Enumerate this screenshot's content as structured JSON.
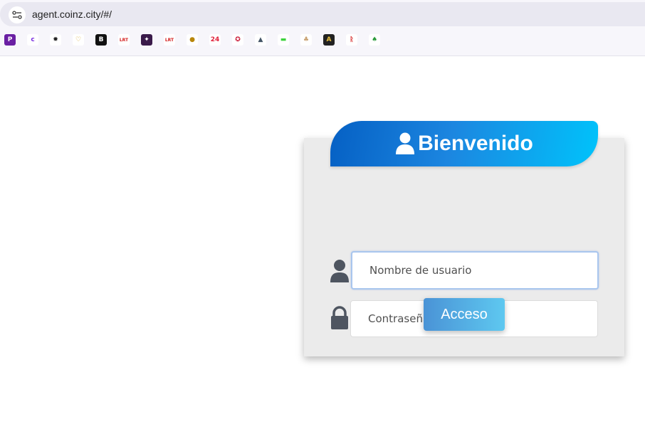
{
  "browser": {
    "url": "agent.coinz.city/#/",
    "bookmarks": [
      {
        "icon": "purple-p-icon",
        "glyph": "P",
        "bg": "#6a1fa3",
        "fg": "#ffffff"
      },
      {
        "icon": "purple-swoosh-icon",
        "glyph": "c",
        "bg": "#ffffff",
        "fg": "#7b2fe0"
      },
      {
        "icon": "gear-gem-icon",
        "glyph": "✹",
        "bg": "#ffffff",
        "fg": "#222222"
      },
      {
        "icon": "gold-heart-icon",
        "glyph": "♡",
        "bg": "#ffffff",
        "fg": "#d4a11c"
      },
      {
        "icon": "black-b-icon",
        "glyph": "B",
        "bg": "#111111",
        "fg": "#ffffff"
      },
      {
        "icon": "lrt-red-icon",
        "glyph": "LRT",
        "bg": "#ffffff",
        "fg": "#d42020"
      },
      {
        "icon": "dark-flag-icon",
        "glyph": "✦",
        "bg": "#3a1a4a",
        "fg": "#ffffff"
      },
      {
        "icon": "lrt-red-icon-2",
        "glyph": "LRT",
        "bg": "#ffffff",
        "fg": "#d42020"
      },
      {
        "icon": "gold-coin-icon",
        "glyph": "●",
        "bg": "#ffffff",
        "fg": "#b8860b"
      },
      {
        "icon": "red-24-icon",
        "glyph": "24",
        "bg": "#ffffff",
        "fg": "#e0203a"
      },
      {
        "icon": "red-chip-icon",
        "glyph": "✪",
        "bg": "#ffffff",
        "fg": "#c8102e"
      },
      {
        "icon": "wolf-icon",
        "glyph": "▲",
        "bg": "#ffffff",
        "fg": "#445566"
      },
      {
        "icon": "green-tag-icon",
        "glyph": "▬",
        "bg": "#ffffff",
        "fg": "#3cd23c"
      },
      {
        "icon": "clover-icon",
        "glyph": "♣",
        "bg": "#ffffff",
        "fg": "#c8a070"
      },
      {
        "icon": "dark-a-icon",
        "glyph": "A",
        "bg": "#222222",
        "fg": "#e8c040"
      },
      {
        "icon": "red-logo-icon",
        "glyph": "ᚱ",
        "bg": "#ffffff",
        "fg": "#d42020"
      },
      {
        "icon": "green-spade-icon",
        "glyph": "♠",
        "bg": "#ffffff",
        "fg": "#2a9a3a"
      }
    ]
  },
  "login": {
    "title": "Bienvenido",
    "username_placeholder": "Nombre de usuario",
    "password_placeholder": "Contraseña",
    "submit_label": "Acceso"
  },
  "colors": {
    "banner_start": "#0560c4",
    "banner_end": "#00c3fb",
    "button_start": "#4a93d6",
    "button_end": "#5ec8f0",
    "icon_gray": "#4e5560"
  }
}
